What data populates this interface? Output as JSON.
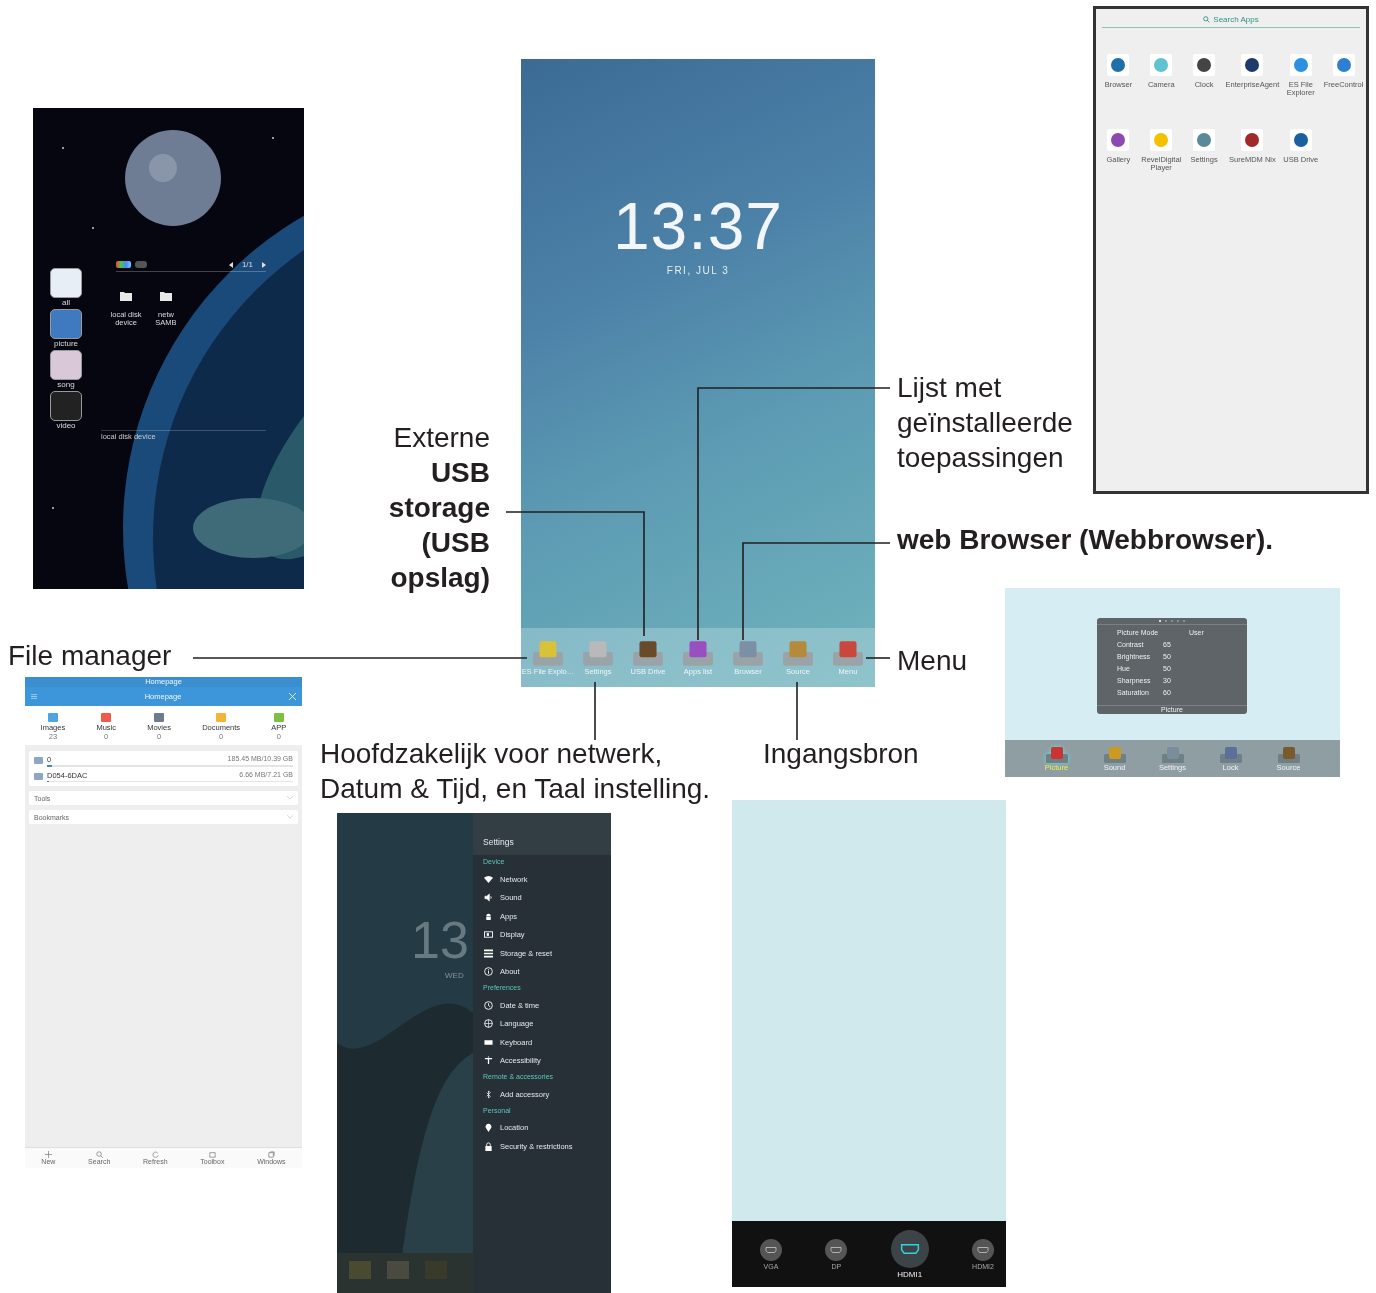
{
  "annotations": {
    "usb_storage": "Externe **USB storage (USB opslag)**",
    "apps_list": "Lijst met geïnstalleerde toepassingen",
    "web_browser": "web Browser (Webbrowser).",
    "file_manager": "File manager",
    "menu": "Menu",
    "settings": "Hoofdzakelijk voor netwerk, Datum & Tijd, en Taal instelling.",
    "input_source": "Ingangsbron"
  },
  "media_player": {
    "page": "1/1",
    "categories": [
      {
        "label": "all"
      },
      {
        "label": "picture"
      },
      {
        "label": "song"
      },
      {
        "label": "video"
      }
    ],
    "folders": [
      {
        "label": "local disk device"
      },
      {
        "label": "netw SAMB"
      }
    ],
    "status": "local disk device"
  },
  "home_screen": {
    "time": "13:37",
    "date": "FRI, JUL 3",
    "dock": [
      {
        "label": "ES File Explo…"
      },
      {
        "label": "Settings"
      },
      {
        "label": "USB Drive"
      },
      {
        "label": "Apps list"
      },
      {
        "label": "Browser"
      },
      {
        "label": "Source"
      },
      {
        "label": "Menu"
      }
    ]
  },
  "apps_list": {
    "search": "Search Apps",
    "apps": [
      {
        "label": "Browser"
      },
      {
        "label": "Camera"
      },
      {
        "label": "Clock"
      },
      {
        "label": "EnterpriseAgent"
      },
      {
        "label": "ES File Explorer"
      },
      {
        "label": "FreeControl"
      },
      {
        "label": "Gallery"
      },
      {
        "label": "RevelDigital Player"
      },
      {
        "label": "Settings"
      },
      {
        "label": "SureMDM Nix"
      },
      {
        "label": "USB Drive"
      }
    ]
  },
  "file_manager": {
    "status_title": "Homepage",
    "title": "Homepage",
    "categories": [
      {
        "label": "Images",
        "count": "23"
      },
      {
        "label": "Music",
        "count": "0"
      },
      {
        "label": "Movies",
        "count": "0"
      },
      {
        "label": "Documents",
        "count": "0"
      },
      {
        "label": "APP",
        "count": "0"
      }
    ],
    "storage": [
      {
        "name": "0",
        "usage": "185.45 MB/10.39 GB",
        "level": 0.02
      },
      {
        "name": "D054-6DAC",
        "usage": "6.66 MB/7.21 GB",
        "level": 0.01
      }
    ],
    "sections": [
      {
        "label": "Tools"
      },
      {
        "label": "Bookmarks"
      }
    ],
    "toolbar": [
      {
        "label": "New",
        "kind": "plus"
      },
      {
        "label": "Search",
        "kind": "search"
      },
      {
        "label": "Refresh",
        "kind": "refresh"
      },
      {
        "label": "Toolbox",
        "kind": "toolbox"
      },
      {
        "label": "Windows",
        "kind": "windows"
      }
    ]
  },
  "settings": {
    "behind_time": "13",
    "behind_day": "WED",
    "title": "Settings",
    "groups": [
      {
        "title": "Device",
        "items": [
          {
            "label": "Network",
            "kind": "wifi"
          },
          {
            "label": "Sound",
            "kind": "sound"
          },
          {
            "label": "Apps",
            "kind": "android"
          },
          {
            "label": "Display",
            "kind": "display"
          },
          {
            "label": "Storage & reset",
            "kind": "storage"
          },
          {
            "label": "About",
            "kind": "info"
          }
        ]
      },
      {
        "title": "Preferences",
        "items": [
          {
            "label": "Date & time",
            "kind": "clock"
          },
          {
            "label": "Language",
            "kind": "globe"
          },
          {
            "label": "Keyboard",
            "kind": "keyboard"
          },
          {
            "label": "Accessibility",
            "kind": "person"
          }
        ]
      },
      {
        "title": "Remote & accessories",
        "items": [
          {
            "label": "Add accessory",
            "kind": "bluetooth"
          }
        ]
      },
      {
        "title": "Personal",
        "items": [
          {
            "label": "Location",
            "kind": "pin"
          },
          {
            "label": "Security & restrictions",
            "kind": "lock"
          }
        ]
      }
    ]
  },
  "osd_menu": {
    "pages": [
      {
        "selected": true
      },
      {
        "selected": false
      },
      {
        "selected": false
      },
      {
        "selected": false
      },
      {
        "selected": false
      }
    ],
    "rows": [
      {
        "label": "Picture Mode",
        "value": "User",
        "kind": "mode"
      },
      {
        "label": "Contrast",
        "value": "65",
        "kind": "number"
      },
      {
        "label": "Brightness",
        "value": "50",
        "kind": "number"
      },
      {
        "label": "Hue",
        "value": "50",
        "kind": "number"
      },
      {
        "label": "Sharpness",
        "value": "30",
        "kind": "number"
      },
      {
        "label": "Saturation",
        "value": "60",
        "kind": "number"
      }
    ],
    "title": "Picture",
    "tabs": [
      {
        "label": "Picture",
        "selected": true
      },
      {
        "label": "Sound",
        "selected": false
      },
      {
        "label": "Settings",
        "selected": false
      },
      {
        "label": "Lock",
        "selected": false
      },
      {
        "label": "Source",
        "selected": false
      }
    ]
  },
  "source_menu": {
    "sources": [
      {
        "label": "VGA",
        "selected": false
      },
      {
        "label": "DP",
        "selected": false
      },
      {
        "label": "HDMI1",
        "selected": true
      },
      {
        "label": "HDMI2",
        "selected": false
      }
    ]
  }
}
